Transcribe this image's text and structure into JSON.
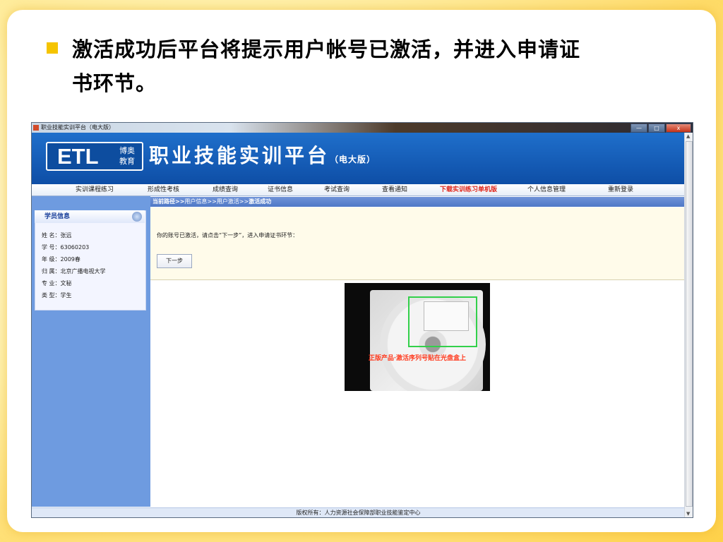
{
  "slide": {
    "bullet_part1": "激活成功后平台将提示用户帐号已激活，",
    "bullet_part2": "并进入申请证",
    "bullet_line2": "书环节。"
  },
  "window": {
    "title": "职业技能实训平台（电大版）",
    "buttons": {
      "minimize": "—",
      "maximize": "□",
      "close": "x"
    }
  },
  "banner": {
    "logo_text": "ETL",
    "logo_sub_line1": "博奥",
    "logo_sub_line2": "教育",
    "title": "职业技能实训平台",
    "edition": "（电大版）"
  },
  "nav": {
    "items": [
      "实训课程练习",
      "形成性考核",
      "成绩查询",
      "证书信息",
      "考试查询",
      "查看通知",
      "下载实训练习单机版",
      "个人信息管理",
      "重新登录"
    ],
    "highlight_color": "#e0261b"
  },
  "breadcrumb": {
    "prefix": "当前路径>>",
    "path": "用户信息>>用户激活>>",
    "current": "激活成功"
  },
  "sidebar": {
    "header": "学员信息",
    "rows": [
      "姓  名：张远",
      "学  号：63060203",
      "年  级：2009春",
      "归  属：北京广播电视大学",
      "专  业：文秘",
      "类  型：学生"
    ]
  },
  "main": {
    "message": "你的账号已激活，请点击“下一步”，进入申请证书环节：",
    "next_button": "下一步"
  },
  "photo": {
    "caption": "正版产品·激活序列号贴在光盘盒上"
  },
  "footer": {
    "text": "版权所有：人力资源社会保障部职业技能鉴定中心"
  },
  "colors": {
    "accent_yellow": "#f5c400",
    "banner_blue": "#1f6fcb",
    "sidebar_blue": "#6e9be0"
  }
}
